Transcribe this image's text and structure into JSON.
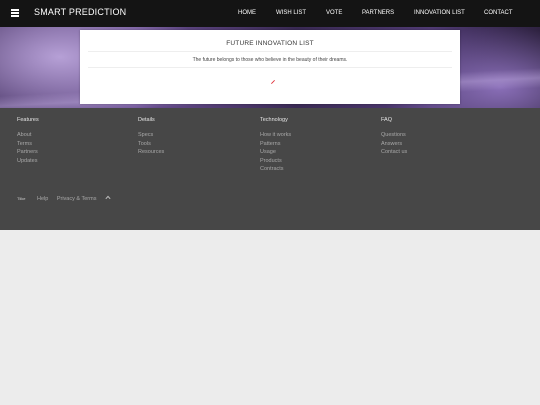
{
  "header": {
    "brand": "SMART PREDICTION",
    "nav": [
      "HOME",
      "WISH LIST",
      "VOTE",
      "PARTNERS",
      "INNOVATION LIST",
      "CONTACT"
    ]
  },
  "card": {
    "title": "FUTURE INNOVATION LIST",
    "subtitle": "The future belongs to those who believe in the beauty of their dreams."
  },
  "footer": {
    "columns": [
      {
        "heading": "Features",
        "links": [
          "About",
          "Terms",
          "Partners",
          "Updates"
        ]
      },
      {
        "heading": "Details",
        "links": [
          "Specs",
          "Tools",
          "Resources"
        ]
      },
      {
        "heading": "Technology",
        "links": [
          "How it works",
          "Patterns",
          "Usage",
          "Products",
          "Contracts"
        ]
      },
      {
        "heading": "FAQ",
        "links": [
          "Questions",
          "Answers",
          "Contact us"
        ]
      }
    ],
    "bottom": {
      "logo": "Tlike",
      "help": "Help",
      "privacy": "Privacy & Terms"
    }
  },
  "colors": {
    "topbar": "#141414",
    "footer": "#474747",
    "page": "#ececec",
    "spinner": "#e0303a"
  },
  "icons": {
    "menu": "hamburger-menu-icon",
    "spinner": "loading-spinner-icon",
    "up": "chevron-up-icon"
  }
}
